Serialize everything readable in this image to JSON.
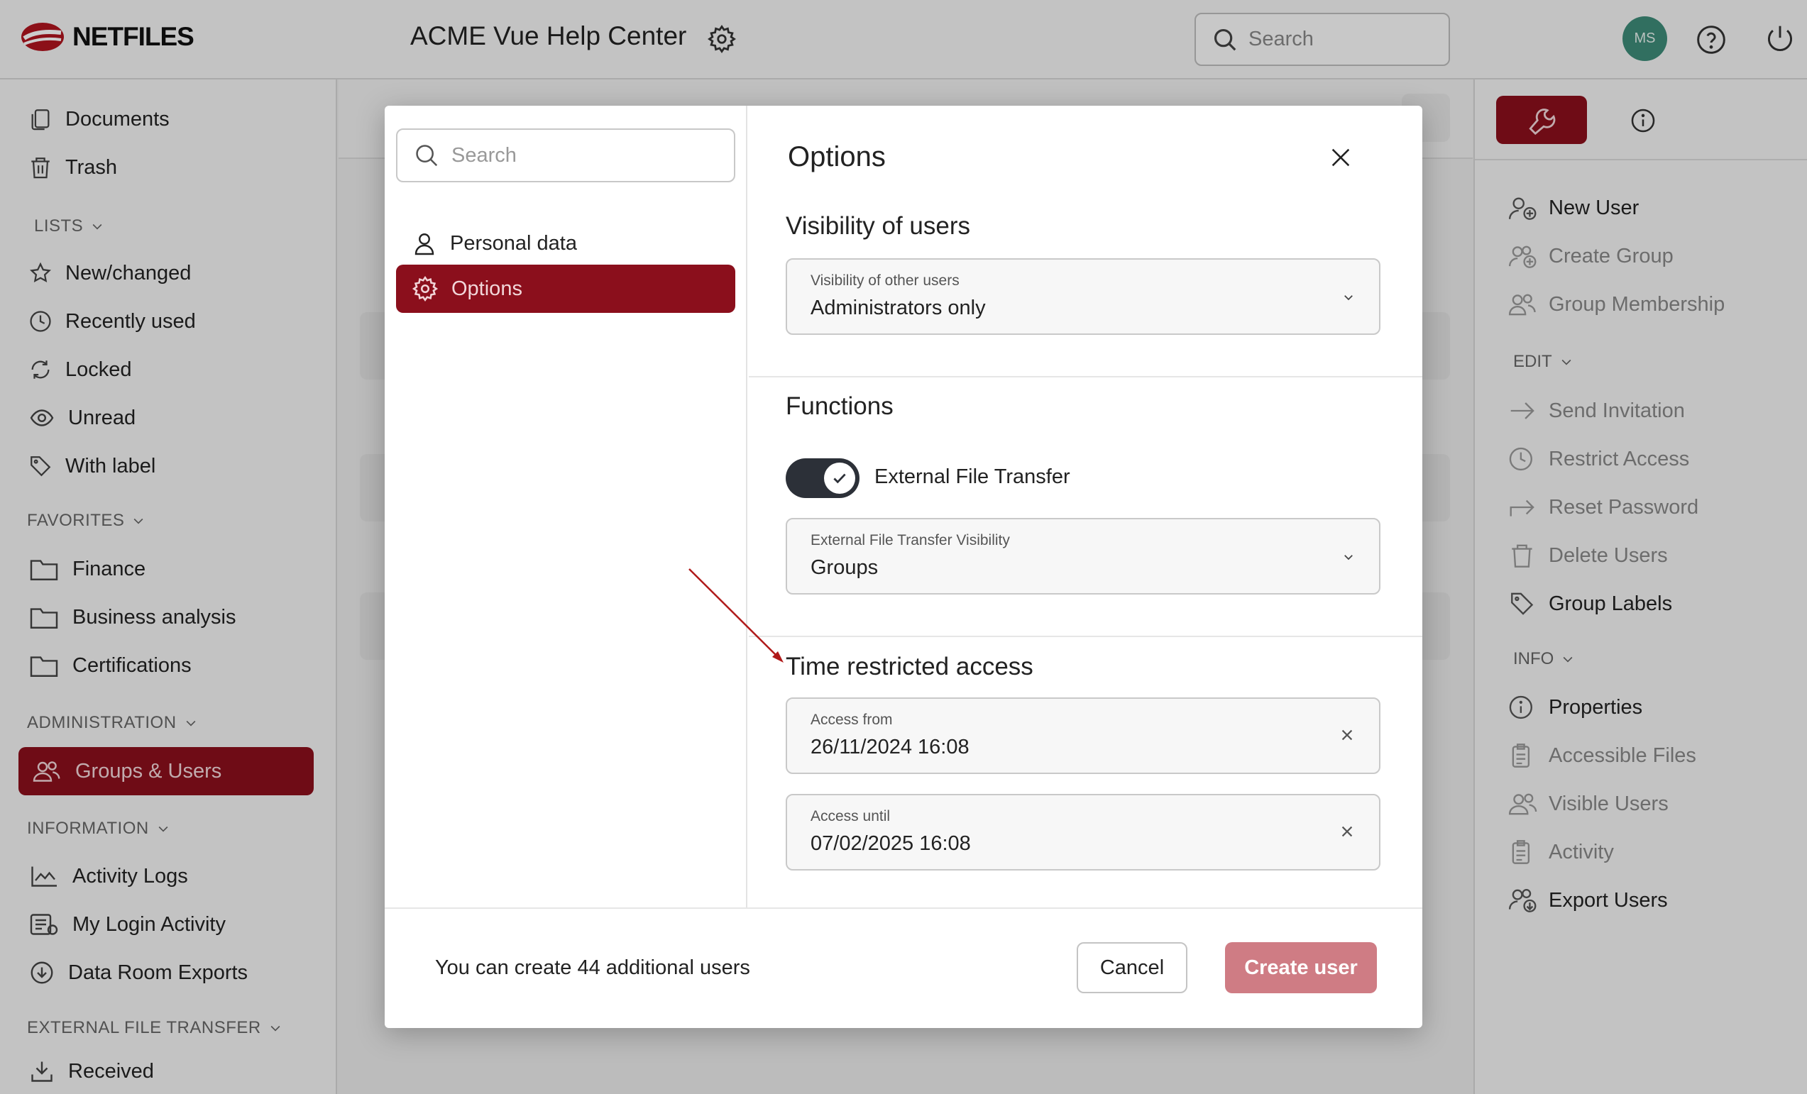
{
  "brand": {
    "name": "NETFILES"
  },
  "header": {
    "title": "ACME Vue Help Center",
    "search_placeholder": "Search",
    "avatar_initials": "MS"
  },
  "sidebar": {
    "top_items": [
      {
        "label": "Documents"
      },
      {
        "label": "Trash"
      }
    ],
    "lists_heading": "LISTS",
    "lists": [
      {
        "label": "New/changed"
      },
      {
        "label": "Recently used"
      },
      {
        "label": "Locked"
      },
      {
        "label": "Unread"
      },
      {
        "label": "With label"
      }
    ],
    "favorites_heading": "FAVORITES",
    "favorites": [
      {
        "label": "Finance"
      },
      {
        "label": "Business analysis"
      },
      {
        "label": "Certifications"
      }
    ],
    "administration_heading": "ADMINISTRATION",
    "administration": [
      {
        "label": "Groups & Users"
      }
    ],
    "information_heading": "INFORMATION",
    "information": [
      {
        "label": "Activity Logs"
      },
      {
        "label": "My Login Activity"
      },
      {
        "label": "Data Room Exports"
      }
    ],
    "eft_heading": "EXTERNAL FILE TRANSFER",
    "eft": [
      {
        "label": "Received"
      }
    ]
  },
  "right_panel": {
    "actions": [
      {
        "label": "New User"
      },
      {
        "label": "Create Group"
      },
      {
        "label": "Group Membership"
      }
    ],
    "edit_heading": "EDIT",
    "edit": [
      {
        "label": "Send Invitation"
      },
      {
        "label": "Restrict Access"
      },
      {
        "label": "Reset Password"
      },
      {
        "label": "Delete Users"
      },
      {
        "label": "Group Labels"
      }
    ],
    "info_heading": "INFO",
    "info": [
      {
        "label": "Properties"
      },
      {
        "label": "Accessible Files"
      },
      {
        "label": "Visible Users"
      },
      {
        "label": "Activity"
      },
      {
        "label": "Export Users"
      }
    ]
  },
  "modal": {
    "search_placeholder": "Search",
    "nav": [
      {
        "label": "Personal data"
      },
      {
        "label": "Options"
      }
    ],
    "title": "Options",
    "visibility": {
      "section_title": "Visibility of users",
      "field_label": "Visibility of other users",
      "value": "Administrators only"
    },
    "functions": {
      "section_title": "Functions",
      "toggle_label": "External File Transfer",
      "toggle_on": true,
      "field_label": "External File Transfer Visibility",
      "value": "Groups"
    },
    "time": {
      "section_title": "Time restricted access",
      "from_label": "Access from",
      "from_value": "26/11/2024 16:08",
      "until_label": "Access until",
      "until_value": "07/02/2025 16:08"
    },
    "footer": {
      "info": "You can create 44 additional users",
      "cancel": "Cancel",
      "create": "Create user"
    }
  },
  "colors": {
    "accent": "#8b0f1c",
    "create_button": "#cf7c84",
    "avatar": "#3e8b78",
    "annotation_arrow": "#b01a1a"
  }
}
